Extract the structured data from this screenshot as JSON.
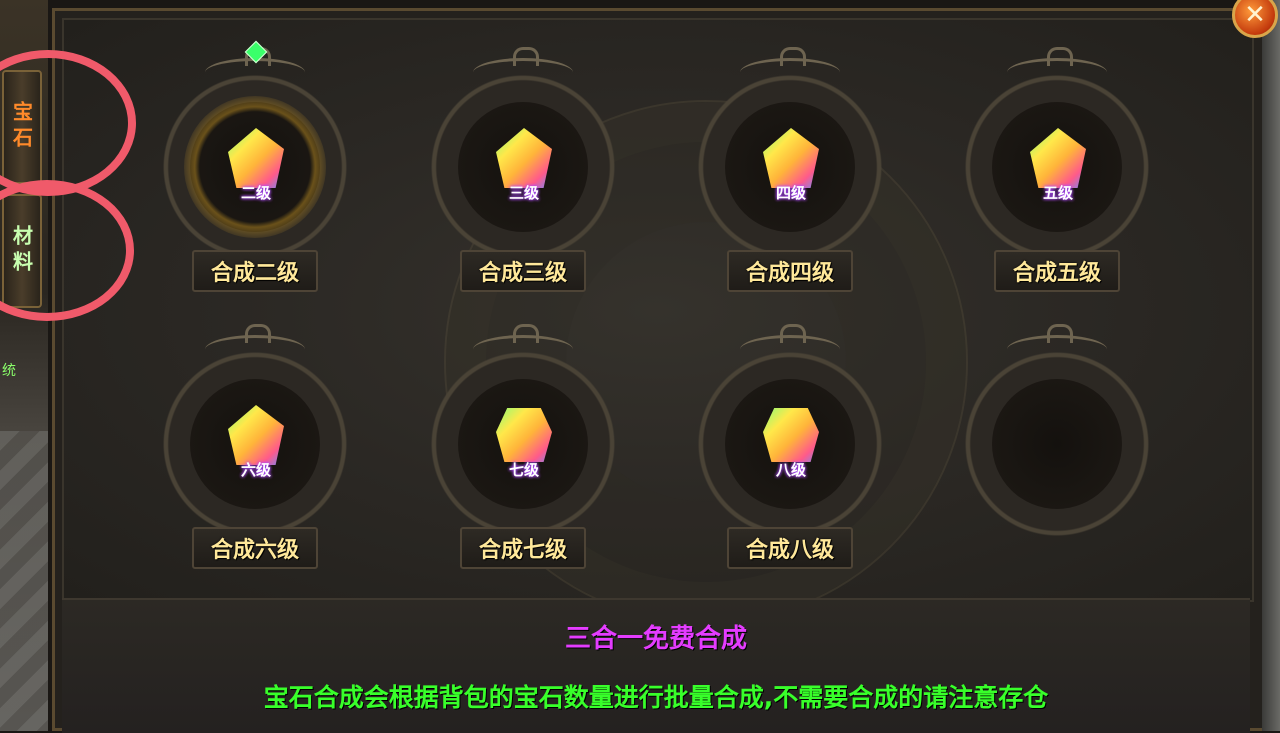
{
  "side_tabs": [
    {
      "label": "宝石",
      "active": true
    },
    {
      "label": "材料",
      "active": false
    }
  ],
  "side_small_label": "统",
  "close_label": "✕",
  "slots": [
    {
      "gem_level": "二级",
      "button": "合成二级",
      "selected": true,
      "empty": false
    },
    {
      "gem_level": "三级",
      "button": "合成三级",
      "selected": false,
      "empty": false
    },
    {
      "gem_level": "四级",
      "button": "合成四级",
      "selected": false,
      "empty": false
    },
    {
      "gem_level": "五级",
      "button": "合成五级",
      "selected": false,
      "empty": false
    },
    {
      "gem_level": "六级",
      "button": "合成六级",
      "selected": false,
      "empty": false
    },
    {
      "gem_level": "七级",
      "button": "合成七级",
      "selected": false,
      "empty": false
    },
    {
      "gem_level": "八级",
      "button": "合成八级",
      "selected": false,
      "empty": false
    },
    {
      "gem_level": "",
      "button": "",
      "selected": false,
      "empty": true
    }
  ],
  "footer": {
    "title": "三合一免费合成",
    "note": "宝石合成会根据背包的宝石数量进行批量合成,不需要合成的请注意存仓"
  },
  "colors": {
    "title": "#e43cff",
    "note": "#38ff2a",
    "button_text": "#ffe89a",
    "active_tab": "#ff8a2a",
    "annotation": "#f05a6a"
  }
}
